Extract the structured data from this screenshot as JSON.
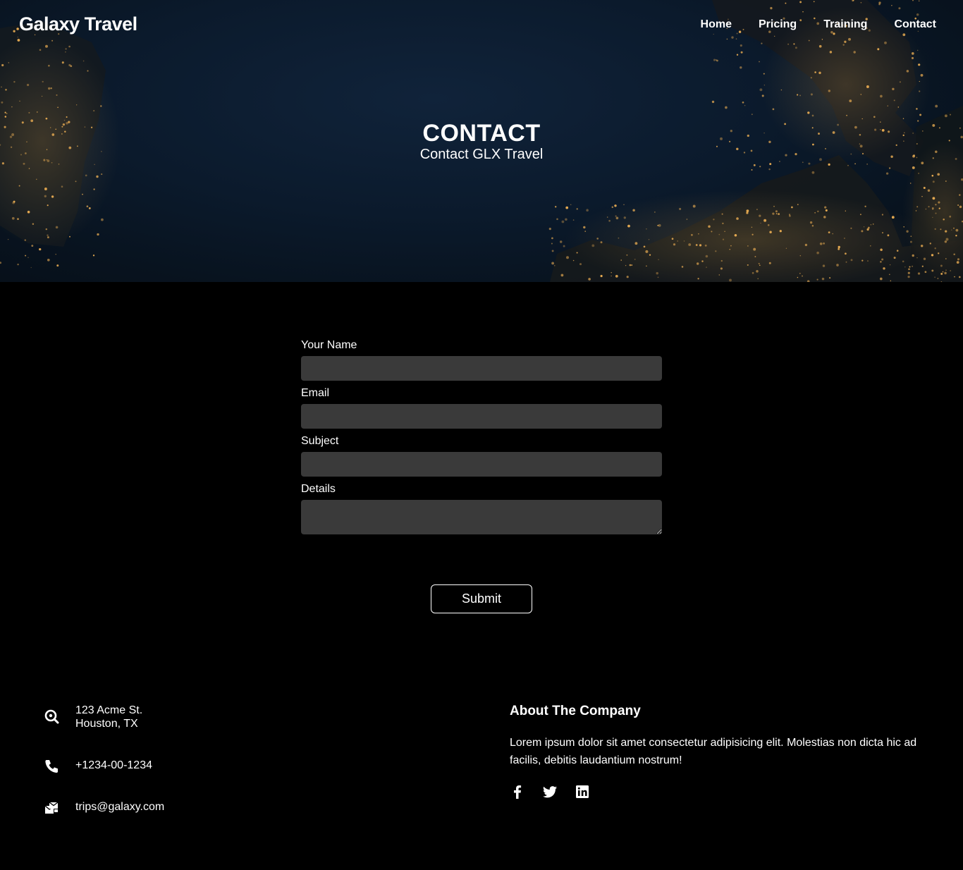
{
  "nav": {
    "brand": "Galaxy Travel",
    "links": [
      "Home",
      "Pricing",
      "Training",
      "Contact"
    ]
  },
  "hero": {
    "title": "CONTACT",
    "subtitle": "Contact GLX Travel"
  },
  "form": {
    "fields": [
      {
        "label": "Your Name",
        "value": "",
        "placeholder": ""
      },
      {
        "label": "Email",
        "value": "",
        "placeholder": ""
      },
      {
        "label": "Subject",
        "value": "",
        "placeholder": ""
      },
      {
        "label": "Details",
        "value": "",
        "placeholder": ""
      }
    ],
    "submit_label": "Submit"
  },
  "footer": {
    "address_line1": "123 Acme St.",
    "address_line2": "Houston, TX",
    "phone": "+1234-00-1234",
    "email": "trips@galaxy.com",
    "about_title": "About The Company",
    "about_text": "Lorem ipsum dolor sit amet consectetur adipisicing elit. Molestias non dicta hic ad facilis, debitis laudantium nostrum!",
    "socials": [
      "facebook-icon",
      "twitter-icon",
      "linkedin-icon"
    ]
  },
  "colors": {
    "background": "#000000",
    "input_background": "#3a3a3a",
    "hero_sea": "#0b1a2c",
    "city_lights": "#e8a443"
  }
}
